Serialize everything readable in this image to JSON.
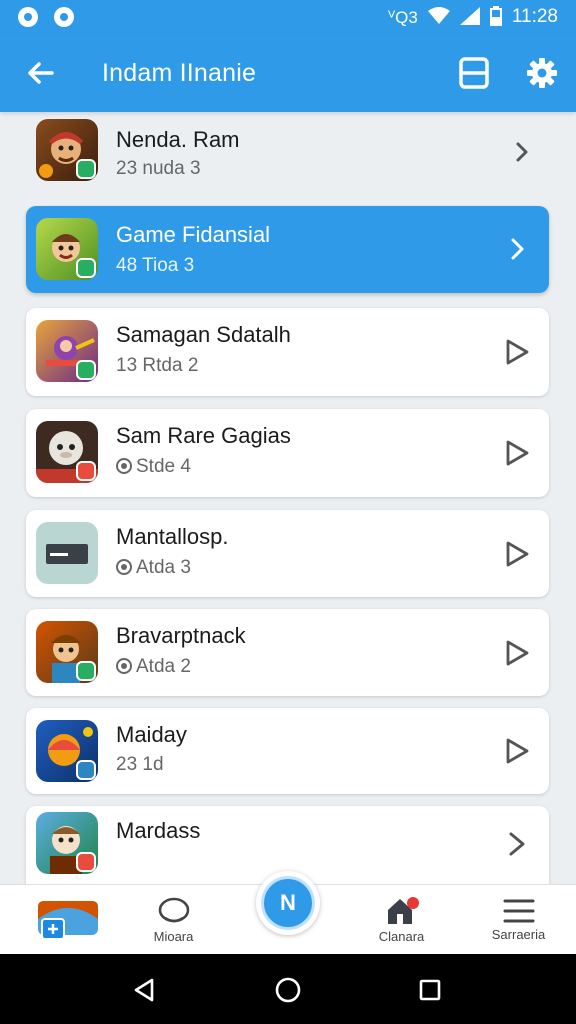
{
  "status_bar": {
    "icons": [
      "app-notification-icon",
      "app-notification-icon",
      "vibrate-icon",
      "wifi-icon",
      "signal-icon",
      "battery-icon"
    ],
    "indicators": "ⱽQ3",
    "time": "11:28"
  },
  "app_bar": {
    "title": "Indam IInanie",
    "back_icon": "arrow-left-icon",
    "actions": [
      "layout-icon",
      "settings-gear-icon"
    ]
  },
  "games": [
    {
      "title": "Nenda. Ram",
      "subtitle": "23 nuda 3",
      "has_sub_icon": false,
      "action": "chevron-right-icon",
      "icon": "warrior-game-icon",
      "style": "plain"
    },
    {
      "title": "Game Fidansial",
      "subtitle": "48 Tioa 3",
      "has_sub_icon": false,
      "action": "chevron-right-icon",
      "icon": "cartoon-hero-game-icon",
      "style": "selected"
    },
    {
      "title": "Samagan Sdatalh",
      "subtitle": "13 Rtda 2",
      "has_sub_icon": false,
      "action": "play-icon",
      "icon": "action-game-icon",
      "style": "card"
    },
    {
      "title": "Sam Rare Gagias",
      "subtitle": "Stde 4",
      "has_sub_icon": true,
      "action": "play-icon",
      "icon": "creature-game-icon",
      "style": "card"
    },
    {
      "title": "Mantallosp.",
      "subtitle": "Atda 3",
      "has_sub_icon": true,
      "action": "play-icon",
      "icon": "placeholder-game-icon",
      "style": "card"
    },
    {
      "title": "Bravarptnack",
      "subtitle": "Atda 2",
      "has_sub_icon": true,
      "action": "play-icon",
      "icon": "adventure-game-icon",
      "style": "card"
    },
    {
      "title": "Maiday",
      "subtitle": "23 1d",
      "has_sub_icon": false,
      "action": "play-icon",
      "icon": "arcade-game-icon",
      "style": "card"
    },
    {
      "title": "Mardass",
      "subtitle": "",
      "has_sub_icon": false,
      "action": "chevron-right-icon",
      "icon": "character-game-icon",
      "style": "card"
    }
  ],
  "bottom_nav": {
    "items": [
      {
        "label": "",
        "icon": "game-thumbnail-icon"
      },
      {
        "label": "Mioara",
        "icon": "chat-bubble-icon"
      },
      {
        "label": "",
        "icon": "center-action-icon",
        "fab_text": "N"
      },
      {
        "label": "Clanara",
        "icon": "home-notification-icon"
      },
      {
        "label": "Sarraeria",
        "icon": "menu-lines-icon"
      }
    ]
  },
  "system_nav": [
    "back-triangle-icon",
    "home-circle-icon",
    "recents-square-icon"
  ],
  "colors": {
    "primary": "#2f9be8",
    "background": "#eceff2",
    "card": "#ffffff",
    "notification": "#e53935"
  }
}
